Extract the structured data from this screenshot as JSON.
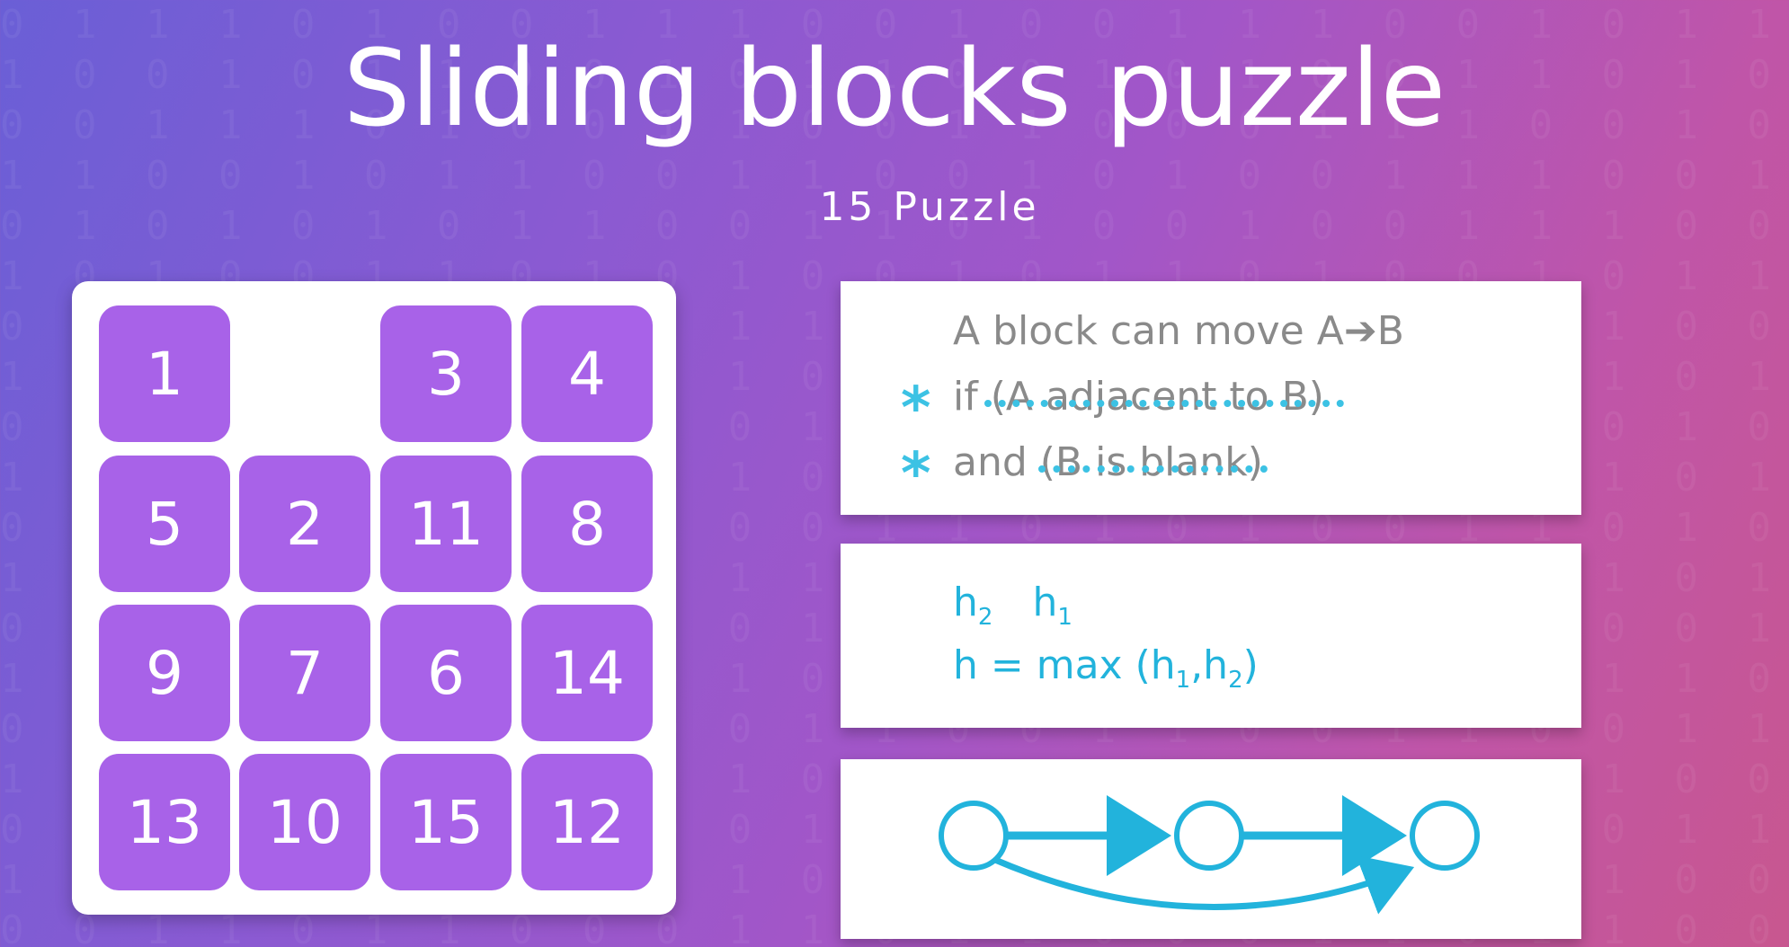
{
  "title": "Sliding blocks puzzle",
  "subtitle": "15 Puzzle",
  "board": {
    "tiles": [
      {
        "label": "1",
        "row": 0,
        "col": 0
      },
      {
        "label": "3",
        "row": 0,
        "col": 2
      },
      {
        "label": "4",
        "row": 0,
        "col": 3
      },
      {
        "label": "5",
        "row": 1,
        "col": 0
      },
      {
        "label": "2",
        "row": 1,
        "col": 1
      },
      {
        "label": "11",
        "row": 1,
        "col": 2
      },
      {
        "label": "8",
        "row": 1,
        "col": 3
      },
      {
        "label": "9",
        "row": 2,
        "col": 0
      },
      {
        "label": "7",
        "row": 2,
        "col": 1
      },
      {
        "label": "6",
        "row": 2,
        "col": 2
      },
      {
        "label": "14",
        "row": 2,
        "col": 3
      },
      {
        "label": "13",
        "row": 3,
        "col": 0
      },
      {
        "label": "10",
        "row": 3,
        "col": 1
      },
      {
        "label": "15",
        "row": 3,
        "col": 2
      },
      {
        "label": "12",
        "row": 3,
        "col": 3
      }
    ],
    "tile_color": "#a862e8"
  },
  "rules": {
    "line1": "A block can move  A➔B",
    "line2": "if (A adjacent to B)",
    "line3": "and (B is blank)",
    "bullet": "*"
  },
  "heuristics": {
    "h2": "h",
    "h2_sub": "2",
    "h1": "h",
    "h1_sub": "1",
    "formula_prefix": "h = max (h",
    "formula_sub1": "1",
    "formula_mid": ",h",
    "formula_sub2": "2",
    "formula_suffix": ")"
  },
  "colors": {
    "accent": "#22b3dc",
    "text_gray": "#8a8a8a"
  }
}
